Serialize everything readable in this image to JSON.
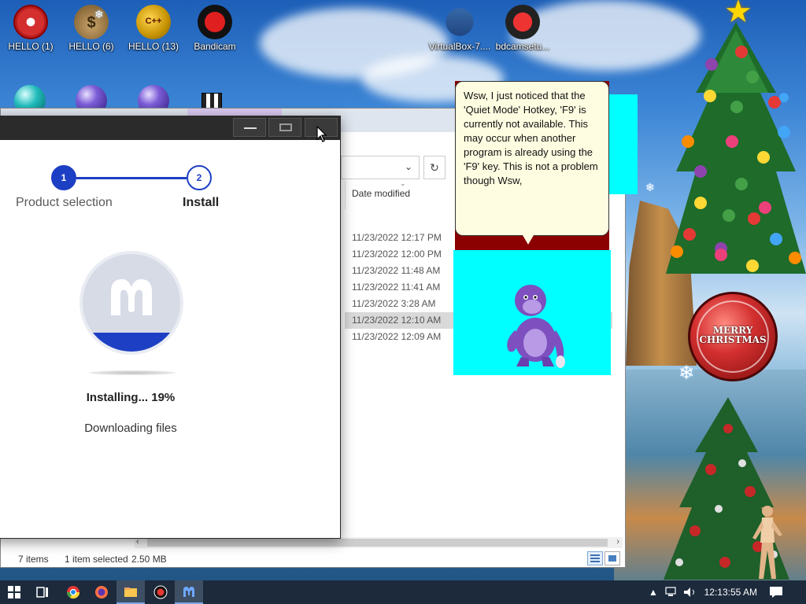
{
  "desktop": {
    "icons": [
      {
        "label": "HELLO (1)",
        "icon": "radiation-icon"
      },
      {
        "label": "HELLO (6)",
        "icon": "money-bag-icon"
      },
      {
        "label": "HELLO (13)",
        "icon": "cpp-gold-icon"
      },
      {
        "label": "Bandicam",
        "icon": "bandicam-record-icon"
      },
      {
        "label": "VirtualBox-7....",
        "icon": "virtualbox-icon"
      },
      {
        "label": "bdcamsetu...",
        "icon": "bandicam-setup-icon"
      }
    ]
  },
  "installer": {
    "steps": [
      {
        "number": "1",
        "label": "Product selection"
      },
      {
        "number": "2",
        "label": "Install"
      }
    ],
    "progress_percent": 19,
    "status": "Installing... 19%",
    "detail": "Downloading files",
    "brand_color": "#1d3fc4"
  },
  "explorer": {
    "column_header": "Date modified",
    "rows": [
      {
        "date": "11/23/2022 12:17 PM",
        "selected": false
      },
      {
        "date": "11/23/2022 12:00 PM",
        "selected": false
      },
      {
        "date": "11/23/2022 11:48 AM",
        "selected": false
      },
      {
        "date": "11/23/2022 11:41 AM",
        "selected": false
      },
      {
        "date": "11/23/2022 3:28 AM",
        "selected": false
      },
      {
        "date": "11/23/2022 12:10 AM",
        "selected": true
      },
      {
        "date": "11/23/2022 12:09 AM",
        "selected": false
      }
    ],
    "status": {
      "items": "7 items",
      "selection": "1 item selected",
      "size": "2.50 MB"
    }
  },
  "bonzi": {
    "message": "Wsw, I just noticed that the 'Quiet Mode' Hotkey, 'F9' is currently not available. This may occur when another program is already using the 'F9' key. This is not a problem though Wsw,"
  },
  "decor": {
    "clock_text": "MERRY CHRISTMAS"
  },
  "taskbar": {
    "items": [
      "start-icon",
      "task-view-icon",
      "chrome-icon",
      "firefox-icon",
      "file-explorer-icon",
      "bandicam-taskbar-icon",
      "malwarebytes-taskbar-icon"
    ],
    "clock": "12:13:55 AM"
  }
}
